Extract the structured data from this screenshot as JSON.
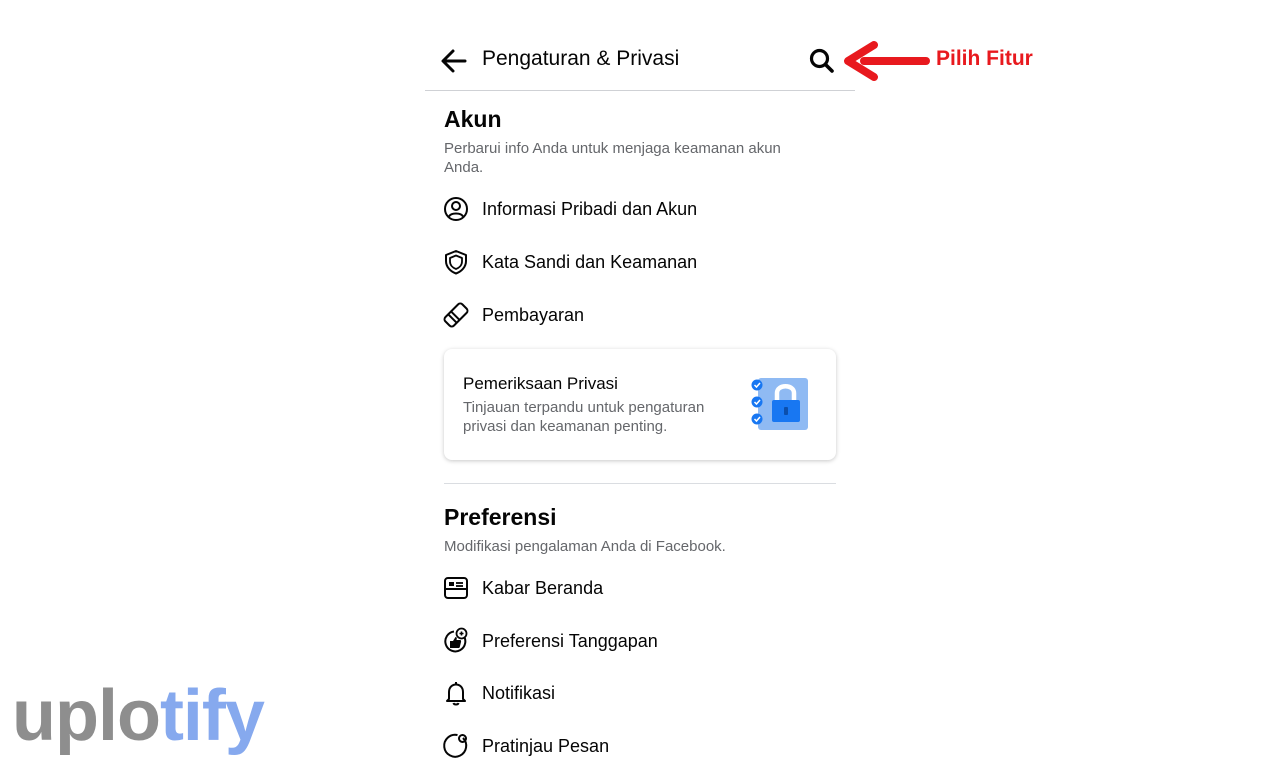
{
  "header": {
    "title": "Pengaturan & Privasi"
  },
  "annotation": {
    "text": "Pilih Fitur",
    "color": "#e8191e"
  },
  "akun": {
    "title": "Akun",
    "subtitle": "Perbarui info Anda untuk menjaga keamanan akun Anda.",
    "items": [
      {
        "label": "Informasi Pribadi dan Akun",
        "icon": "user-circle-icon"
      },
      {
        "label": "Kata Sandi dan Keamanan",
        "icon": "shield-icon"
      },
      {
        "label": "Pembayaran",
        "icon": "payment-tag-icon"
      }
    ]
  },
  "privacy_card": {
    "title": "Pemeriksaan Privasi",
    "description": "Tinjauan terpandu untuk pengaturan privasi dan keamanan penting.",
    "icon": "privacy-lock-illustration"
  },
  "preferensi": {
    "title": "Preferensi",
    "subtitle": "Modifikasi pengalaman Anda di Facebook.",
    "items": [
      {
        "label": "Kabar Beranda",
        "icon": "news-feed-icon"
      },
      {
        "label": "Preferensi Tanggapan",
        "icon": "reaction-preference-icon"
      },
      {
        "label": "Notifikasi",
        "icon": "bell-icon"
      },
      {
        "label": "Pratinjau Pesan",
        "icon": "message-preview-icon"
      }
    ]
  },
  "watermark": {
    "part1": "uplo",
    "part2": "tify"
  },
  "colors": {
    "text_primary": "#050505",
    "text_secondary": "#65676b",
    "accent_blue": "#1877f2",
    "annotation_red": "#e8191e"
  }
}
